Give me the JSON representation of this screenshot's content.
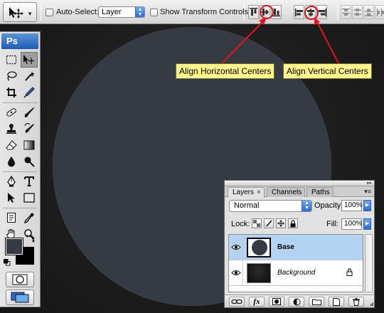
{
  "options_bar": {
    "auto_select_label": "Auto-Select:",
    "auto_select_value": "Layer",
    "show_transform_label": "Show Transform Controls"
  },
  "annotations": {
    "horizontal": "Align Horizontal Centers",
    "vertical": "Align Vertical Centers",
    "accent_color": "#e0141a",
    "callout_color": "#fff38c"
  },
  "toolbox": {
    "logo": "Ps",
    "foreground_color": "#353a43",
    "background_color": "#000000"
  },
  "canvas": {
    "circle_color": "#353a43"
  },
  "layers_panel": {
    "tabs": [
      {
        "label": "Layers",
        "close": "×"
      },
      {
        "label": "Channels"
      },
      {
        "label": "Paths"
      }
    ],
    "blend_mode": "Normal",
    "opacity_label": "Opacity:",
    "opacity_value": "100%",
    "lock_label": "Lock:",
    "fill_label": "Fill:",
    "fill_value": "100%",
    "layers": [
      {
        "name": "Base",
        "selected": true
      },
      {
        "name": "Background",
        "locked": true
      }
    ],
    "footer_fx": "fx"
  }
}
